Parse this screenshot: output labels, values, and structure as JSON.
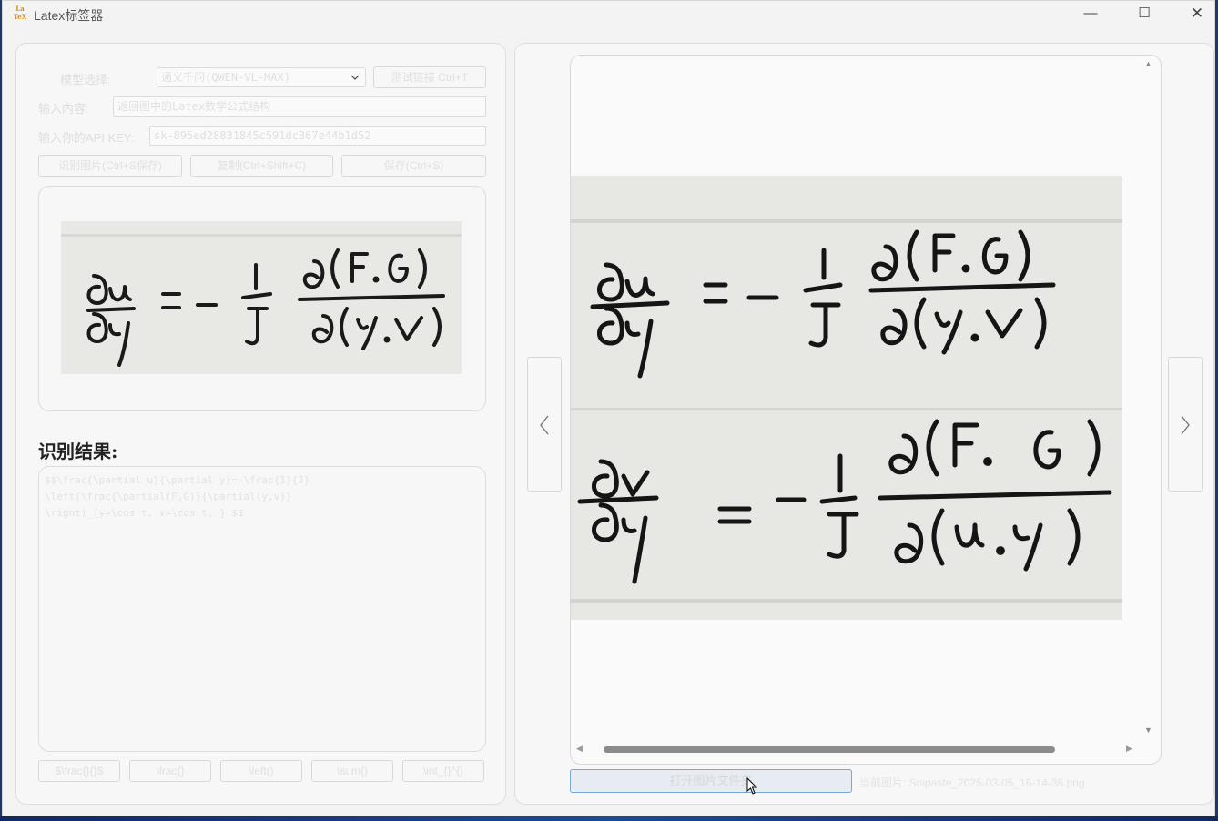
{
  "window": {
    "title": "Latex标签器",
    "icon_text_top": "La",
    "icon_text_bottom": "TeX",
    "minimize_symbol": "—",
    "maximize_symbol": "☐",
    "close_symbol": "✕"
  },
  "settings": {
    "model_label": "模型选择:",
    "model_value": "通义千问(QWEN-VL-MAX)",
    "test_connection_label": "测试链接 Ctrl+T",
    "input_label": "输入内容:",
    "input_value": "返回图中的Latex数学公式结构",
    "api_key_label": "输入你的API KEY:",
    "api_key_value": "sk-895ed28831845c591dc367e44b1d52",
    "recognize_button": "识别图片(Ctrl+S保存)",
    "copy_button": "复制(Ctrl+Shift+C)",
    "save_button": "保存(Ctrl+S)"
  },
  "result": {
    "heading": "识别结果:",
    "latex_text": "$$\\frac{\\partial u}{\\partial y}=-\\frac{1}{J}\n\\left(\\frac{\\partial(F,G)}{\\partial(y,v)}\n\\right)_{y=\\cos t, v=\\cos t, } $$"
  },
  "bottom_buttons": [
    "$\\frac{}{}$",
    "\\frac{}",
    "\\left()",
    "\\sum{}",
    "\\int_{}^{}"
  ],
  "viewer": {
    "open_folder_button": "打开图片文件夹",
    "current_image_label": "当前图片: Snipaste_2025-03-05_16-14-36.png",
    "prev_symbol": "‹",
    "next_symbol": "›"
  }
}
